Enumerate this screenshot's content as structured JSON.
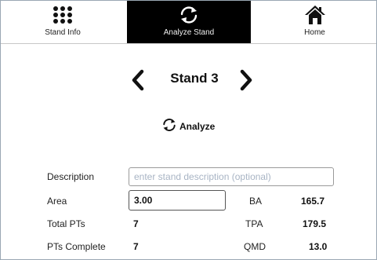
{
  "tabs": [
    {
      "label": "Stand Info",
      "icon": "grid-dots-icon",
      "active": false
    },
    {
      "label": "Analyze Stand",
      "icon": "refresh-icon",
      "active": true
    },
    {
      "label": "Home",
      "icon": "home-icon",
      "active": false
    }
  ],
  "stand": {
    "title": "Stand 3",
    "analyze_label": "Analyze"
  },
  "form": {
    "description_label": "Description",
    "description_placeholder": "enter stand description (optional)",
    "description_value": "",
    "area_label": "Area",
    "area_value": "3.00",
    "total_pts_label": "Total PTs",
    "total_pts_value": "7",
    "pts_complete_label": "PTs Complete",
    "pts_complete_value": "7"
  },
  "stats": {
    "ba_label": "BA",
    "ba_value": "165.7",
    "tpa_label": "TPA",
    "tpa_value": "179.5",
    "qmd_label": "QMD",
    "qmd_value": "13.0"
  },
  "colors": {
    "active_tab_bg": "#000000",
    "active_tab_text": "#f0f0f0",
    "border": "#9aa7b3",
    "placeholder": "#a8b4c4"
  }
}
